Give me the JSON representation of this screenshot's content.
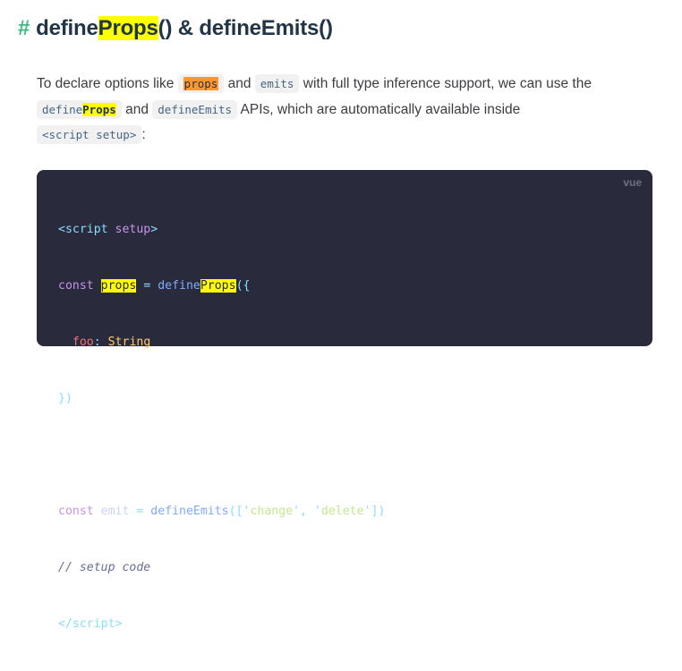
{
  "heading": {
    "hash": "#",
    "part1": "define",
    "highlight": "Props",
    "part2": "() & defineEmits()"
  },
  "paragraph": {
    "text1": "To declare options like ",
    "code_props": "props",
    "text2": " and ",
    "code_emits": "emits",
    "text3": " with full type inference support, we can use the ",
    "code_defineprops_1": "define",
    "code_defineprops_hl": "Props",
    "text4": " and ",
    "code_defineemits": "defineEmits",
    "text5": " APIs, which are automatically available inside ",
    "code_script_setup": "<script setup>",
    "text6": ":"
  },
  "code_block": {
    "language": "vue",
    "lines": {
      "l1_open": "<",
      "l1_tag": "script",
      "l1_attr": "setup",
      "l1_close": ">",
      "l2_const": "const",
      "l2_var": "props",
      "l2_eq": "=",
      "l2_fn1": "define",
      "l2_fn_hl": "Props",
      "l2_punc": "({",
      "l3_prop": "foo",
      "l3_colon": ":",
      "l3_type": "String",
      "l4_punc": "})",
      "l6_const": "const",
      "l6_var": "emit",
      "l6_eq": "=",
      "l6_fn": "defineEmits",
      "l6_open": "([",
      "l6_q1": "'",
      "l6_str1": "change",
      "l6_q2": "'",
      "l6_comma": ",",
      "l6_q3": "'",
      "l6_str2": "delete",
      "l6_q4": "'",
      "l6_close": "])",
      "l7_comment": "// setup code",
      "l8_open": "</",
      "l8_tag": "script",
      "l8_close": ">"
    }
  },
  "colors": {
    "hash_accent": "#42b883",
    "search_highlight": "#ffff00",
    "current_match_highlight": "#ff9632",
    "code_background": "#292b3c"
  }
}
